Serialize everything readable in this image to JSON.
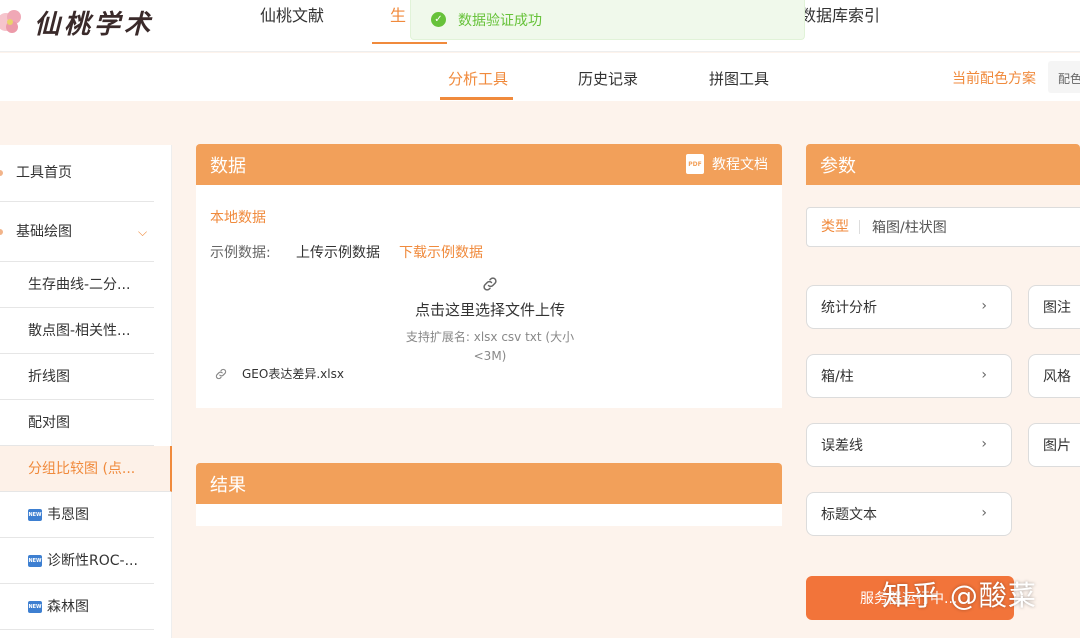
{
  "logo": {
    "text": "仙桃学术"
  },
  "topnav": {
    "items": [
      "仙桃文献",
      "生",
      "数据库索引"
    ]
  },
  "toast": {
    "message": "数据验证成功"
  },
  "subnav": {
    "tabs": [
      "分析工具",
      "历史记录",
      "拼图工具"
    ],
    "scheme_label": "当前配色方案",
    "scheme_value": "配色"
  },
  "sidebar": {
    "items": [
      {
        "label": "工具首页"
      },
      {
        "label": "基础绘图"
      },
      {
        "label": "生存曲线-二分..."
      },
      {
        "label": "散点图-相关性..."
      },
      {
        "label": "折线图"
      },
      {
        "label": "配对图"
      },
      {
        "label": "分组比较图 (点..."
      },
      {
        "label": "韦恩图",
        "badge": "NEW"
      },
      {
        "label": "诊断性ROC-...",
        "badge": "NEW"
      },
      {
        "label": "森林图",
        "badge": "NEW"
      }
    ]
  },
  "data_panel": {
    "title": "数据",
    "doc_link": "教程文档",
    "doc_icon_text": "PDF",
    "local_title": "本地数据",
    "example_label": "示例数据:",
    "upload_example": "上传示例数据",
    "download_example": "下载示例数据",
    "upload_text": "点击这里选择文件上传",
    "upload_hint": "支持扩展名: xlsx csv txt (大小<3M)",
    "file_name": "GEO表达差异.xlsx"
  },
  "result_panel": {
    "title": "结果"
  },
  "params_panel": {
    "title": "参数",
    "type_label": "类型",
    "type_value": "箱图/柱状图",
    "left_buttons": [
      "统计分析",
      "箱/柱",
      "误差线",
      "标题文本"
    ],
    "right_buttons": [
      "图注",
      "风格",
      "图片"
    ],
    "submit": "服务器运行中..."
  },
  "watermark": "知乎 @酸菜",
  "colors": {
    "accent": "#f08a3c",
    "panel_header": "#f2a05a",
    "success": "#67c23a"
  }
}
